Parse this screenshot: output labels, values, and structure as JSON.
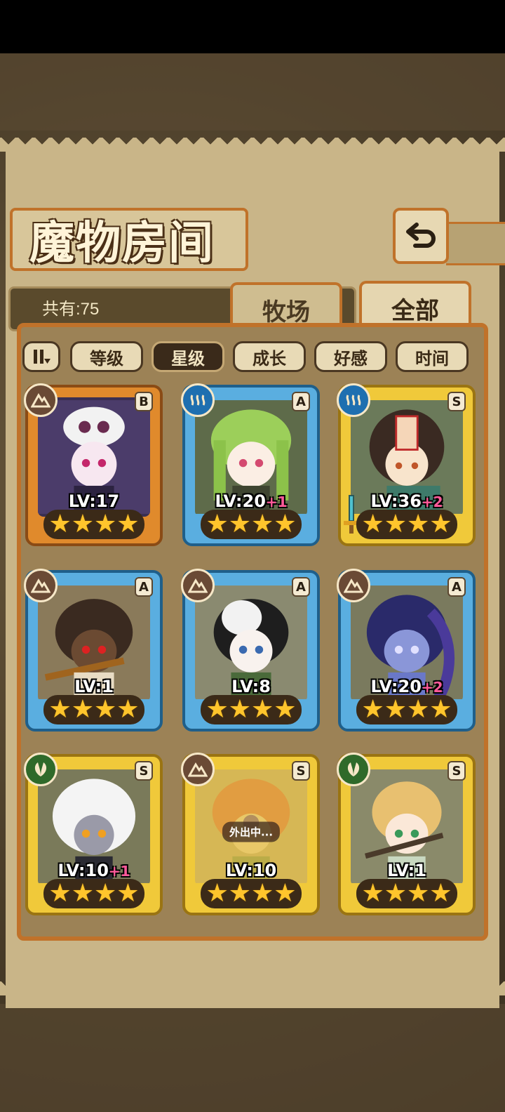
{
  "title": "魔物房间",
  "count_label": "共有:75",
  "tabs": {
    "ranch": "牧场",
    "all": "全部"
  },
  "sort_buttons": [
    "等级",
    "星级",
    "成长",
    "好感",
    "时间"
  ],
  "active_sort": "星级",
  "colors": {
    "bronze": "#e08a2c",
    "blue": "#5aaee0",
    "gold": "#f0c93a",
    "accent": "#c0722a"
  },
  "cards": [
    {
      "element": "earth",
      "grade": "B",
      "frame": "bronze",
      "level": "LV:17",
      "bonus": "",
      "stars": "★★★★",
      "status": ""
    },
    {
      "element": "water",
      "grade": "A",
      "frame": "blue",
      "level": "LV:20",
      "bonus": "+1",
      "stars": "★★★★",
      "status": ""
    },
    {
      "element": "water",
      "grade": "S",
      "frame": "gold",
      "level": "LV:36",
      "bonus": "+2",
      "stars": "★★★★",
      "status": ""
    },
    {
      "element": "earth",
      "grade": "A",
      "frame": "blue",
      "level": "LV:1",
      "bonus": "",
      "stars": "★★★★",
      "status": ""
    },
    {
      "element": "earth",
      "grade": "A",
      "frame": "blue",
      "level": "LV:8",
      "bonus": "",
      "stars": "★★★★",
      "status": ""
    },
    {
      "element": "earth",
      "grade": "A",
      "frame": "blue",
      "level": "LV:20",
      "bonus": "+2",
      "stars": "★★★★",
      "status": ""
    },
    {
      "element": "leaf",
      "grade": "S",
      "frame": "gold",
      "level": "LV:10",
      "bonus": "+1",
      "stars": "★★★★",
      "status": ""
    },
    {
      "element": "earth",
      "grade": "S",
      "frame": "gold",
      "level": "LV:10",
      "bonus": "",
      "stars": "★★★★",
      "status": "外出中..."
    },
    {
      "element": "leaf",
      "grade": "S",
      "frame": "gold",
      "level": "LV:1",
      "bonus": "",
      "stars": "★★★★",
      "status": ""
    }
  ]
}
